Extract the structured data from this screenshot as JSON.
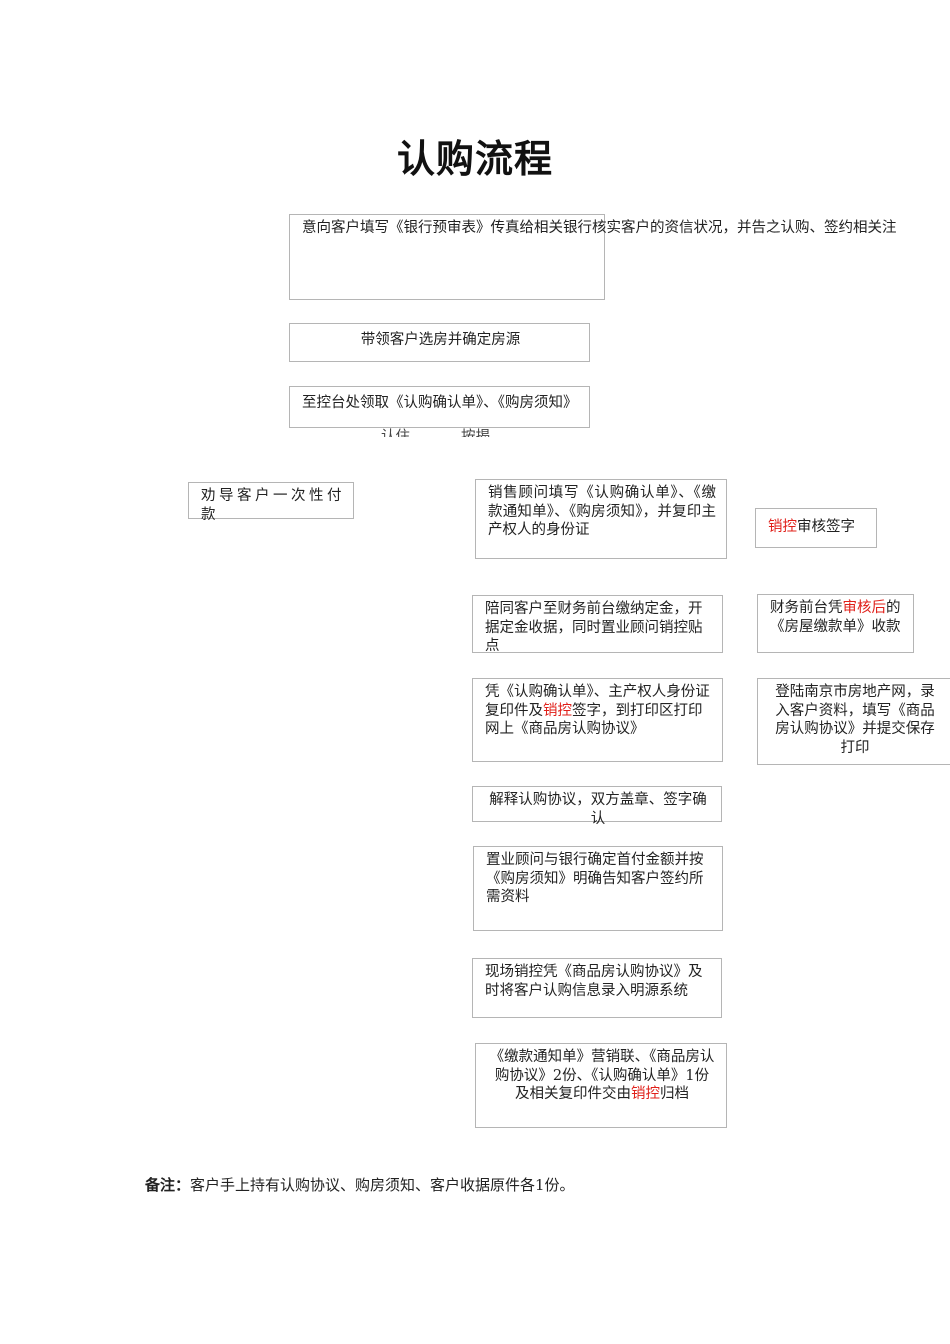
{
  "title": "认购流程",
  "steps": {
    "bank_precheck": "意向客户填写《银行预审表》传真给相关银行核实客户的资信状况，并告之认购、签约相关注",
    "choose_unit": "带领客户选房并确定房源",
    "collect_forms": "至控台处领取《认购确认单》、《购房须知》",
    "fragment_left": "认住",
    "fragment_right": "按揭",
    "one_time_payment": "劝导客户一次性付款",
    "fill_forms": "销售顾问填写《认购确认单》、《缴款通知单》、《购房须知》，并复印主产权人的身份证",
    "control_sign": {
      "red": "销控",
      "rest": "审核签字"
    },
    "deposit": "陪同客户至财务前台缴纳定金，开据定金收据，同时置业顾问销控贴点",
    "finance_receipt": {
      "pre": "财务前台凭",
      "red": "审核后",
      "post": "的《房屋缴款单》收款"
    },
    "print_agreement": {
      "pre": "凭《认购确认单》、主产权人身份证复印件及",
      "red": "销控",
      "post": "签字，到打印区打印网上《商品房认购协议》"
    },
    "nanjing_online": "登陆南京市房地产网，录入客户资料，填写《商品房认购协议》并提交保存打印",
    "explain_agreement": "解释认购协议，双方盖章、签字确认",
    "bank_down_payment": "置业顾问与银行确定首付金额并按《购房须知》明确告知客户签约所需资料",
    "system_entry": "现场销控凭《商品房认购协议》及时将客户认购信息录入明源系统",
    "archive": {
      "pre": "《缴款通知单》营销联、《商品房认购协议》2份、《认购确认单》1份及相关复印件交由",
      "red": "销控",
      "post": "归档"
    }
  },
  "note": {
    "label": "备注：",
    "text": "客户手上持有认购协议、购房须知、客户收据原件各1份。"
  },
  "colors": {
    "accent_red": "#e0201a",
    "box_border": "#b5b5b5"
  }
}
